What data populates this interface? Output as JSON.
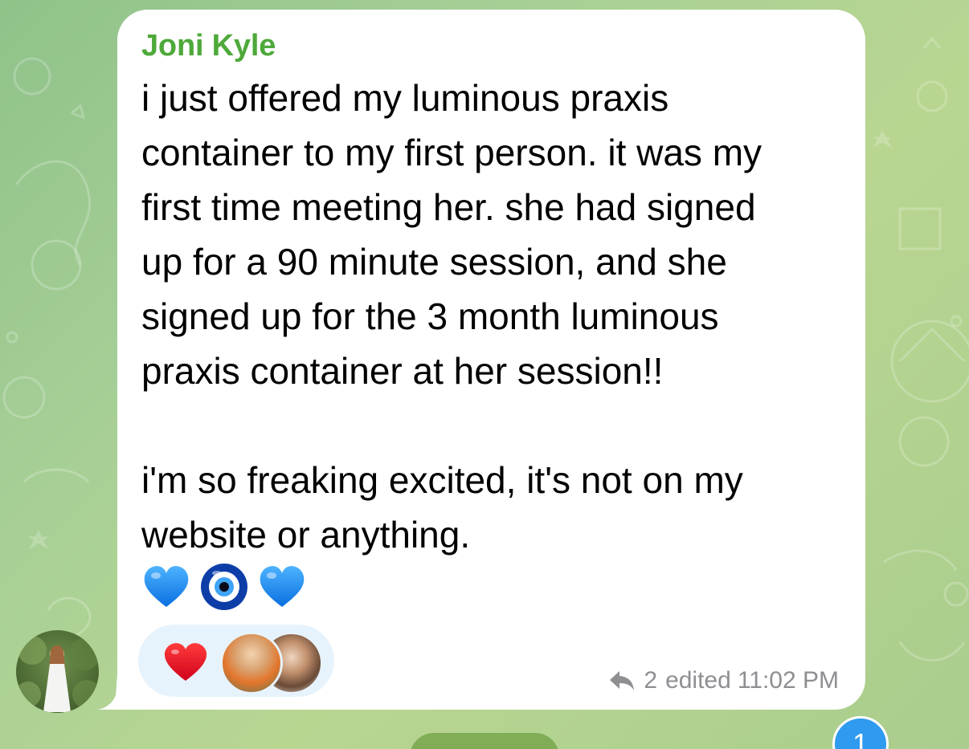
{
  "message": {
    "sender": "Joni Kyle",
    "text": "i just offered my luminous praxis\ncontainer to my first person. it was my\nfirst time meeting her. she had signed\nup for a 90 minute session, and she\nsigned up for the 3 month luminous\npraxis container at her session!!\n\ni'm so freaking excited, it's not on my\nwebsite or anything.",
    "emojis": [
      "blue-heart",
      "nazar-amulet",
      "blue-heart"
    ],
    "reactions": [
      {
        "emoji": "red-heart",
        "reactors": [
          "reactor-avatar-1",
          "reactor-avatar-2"
        ]
      }
    ],
    "reply_count": "2",
    "edited_label": "edited",
    "time": "11:02 PM"
  },
  "scroll_badge": {
    "count": "1"
  },
  "colors": {
    "sender_name": "#4ea93a",
    "bubble": "#ffffff",
    "meta_text": "#8e8e93",
    "reaction_pill": "#e7f3fc",
    "badge": "#2f9bf0"
  }
}
